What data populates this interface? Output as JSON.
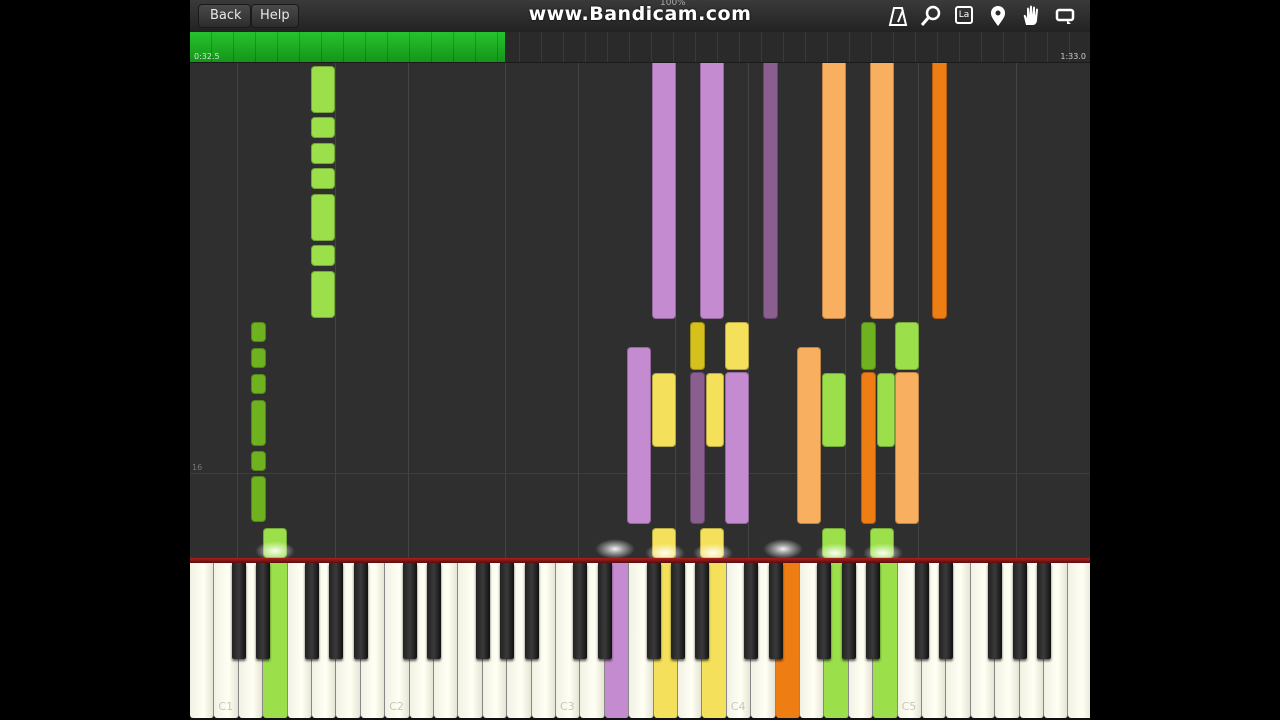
{
  "toolbar": {
    "back_label": "Back",
    "help_label": "Help",
    "watermark": "www.Bandicam.com",
    "speed": "100%",
    "icons": [
      "metronome-icon",
      "search-icon",
      "learn-icon",
      "location-icon",
      "hand-icon",
      "loop-icon"
    ],
    "learn_label": "La"
  },
  "progress": {
    "current_time": "0:32.5",
    "total_time": "1:33.0",
    "fraction": 0.35
  },
  "roll": {
    "measure_number": "16"
  },
  "keyboard": {
    "octave_labels": [
      "C1",
      "C2",
      "C3",
      "C4",
      "C5"
    ]
  },
  "colors": {
    "bright_green": "#9be04a",
    "dark_green": "#6fb21f",
    "purple": "#c58bd0",
    "dark_purple": "#8a5e8f",
    "orange": "#f8b060",
    "dark_orange": "#ee7d14",
    "yellow": "#f4e05a",
    "dark_yellow": "#d6c01c",
    "progress_green": "#22c02a"
  }
}
